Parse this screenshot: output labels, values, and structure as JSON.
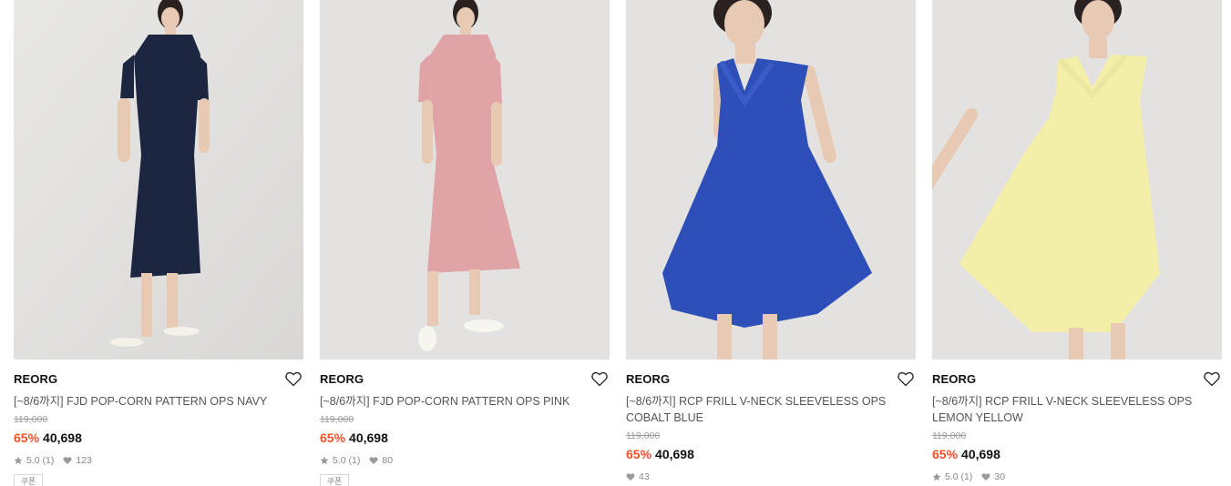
{
  "products": [
    {
      "brand": "REORG",
      "name": "[~8/6까지] FJD POP-CORN PATTERN OPS NAVY",
      "original_price": "119,000",
      "discount": "65%",
      "sale_price": "40,698",
      "rating": "5.0",
      "review_count": "(1)",
      "likes": "123",
      "coupon_label": "쿠폰",
      "image_icon": "dress-photo-navy"
    },
    {
      "brand": "REORG",
      "name": "[~8/6까지] FJD POP-CORN PATTERN OPS PINK",
      "original_price": "119,000",
      "discount": "65%",
      "sale_price": "40,698",
      "rating": "5.0",
      "review_count": "(1)",
      "likes": "80",
      "coupon_label": "쿠폰",
      "image_icon": "dress-photo-pink"
    },
    {
      "brand": "REORG",
      "name": "[~8/6까지] RCP FRILL V-NECK SLEEVELESS OPS COBALT BLUE",
      "original_price": "119,000",
      "discount": "65%",
      "sale_price": "40,698",
      "likes": "43",
      "image_icon": "dress-photo-cobalt"
    },
    {
      "brand": "REORG",
      "name": "[~8/6까지] RCP FRILL V-NECK SLEEVELESS OPS LEMON YELLOW",
      "original_price": "119,000",
      "discount": "65%",
      "sale_price": "40,698",
      "rating": "5.0",
      "review_count": "(1)",
      "likes": "30",
      "image_icon": "dress-photo-yellow"
    }
  ],
  "colors": {
    "discount": "#f0522a",
    "navy_dress": "#1c2640",
    "pink_dress": "#e0a3a6",
    "cobalt_dress": "#2f4fb8",
    "yellow_dress": "#f3efa8",
    "photo_bg": "#e3e2e0"
  }
}
